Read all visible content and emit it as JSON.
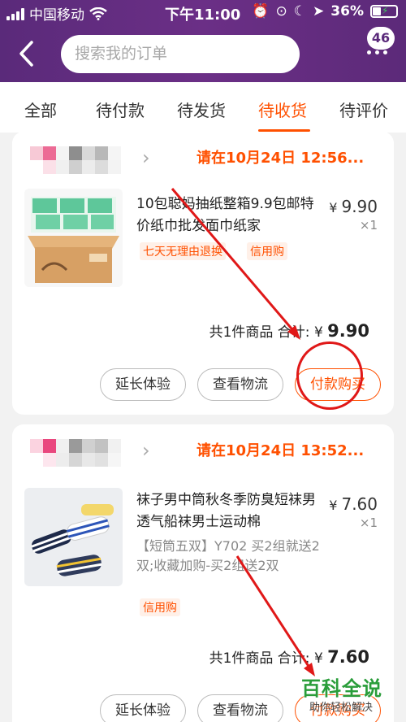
{
  "status_bar": {
    "carrier": "中国移动",
    "time": "下午11:00",
    "battery": "36%"
  },
  "header": {
    "search_placeholder": "搜索我的订单",
    "message_count": "46"
  },
  "tabs": [
    {
      "label": "全部"
    },
    {
      "label": "待付款"
    },
    {
      "label": "待发货"
    },
    {
      "label": "待收货",
      "active": true
    },
    {
      "label": "待评价"
    }
  ],
  "orders": [
    {
      "deadline": "请在10月24日 12:56...",
      "title": "10包聪妈抽纸整箱9.9包邮特价纸巾批发面巾纸家",
      "currency": "¥",
      "price": "9.90",
      "qty": "×1",
      "tags": [
        "七天无理由退换",
        "信用购"
      ],
      "summary": "共1件商品 合计:",
      "total": "9.90",
      "buttons": [
        "延长体验",
        "查看物流",
        "付款购买"
      ]
    },
    {
      "deadline": "请在10月24日 13:52...",
      "title": "袜子男中筒秋冬季防臭短袜男透气船袜男士运动棉",
      "currency": "¥",
      "price": "7.60",
      "qty": "×1",
      "sku": "【短筒五双】Y702 买2组就送2双;收藏加购-买2组送2双",
      "tags": [
        "信用购"
      ],
      "summary": "共1件商品 合计:",
      "total": "7.60",
      "buttons": [
        "延长体验",
        "查看物流",
        "付款购买"
      ]
    }
  ],
  "watermark": {
    "main": "百科全说",
    "sub": "助你轻松解决"
  },
  "colors": {
    "header": "#5a2a7a",
    "accent": "#ff5000",
    "annotation": "#e01818"
  }
}
